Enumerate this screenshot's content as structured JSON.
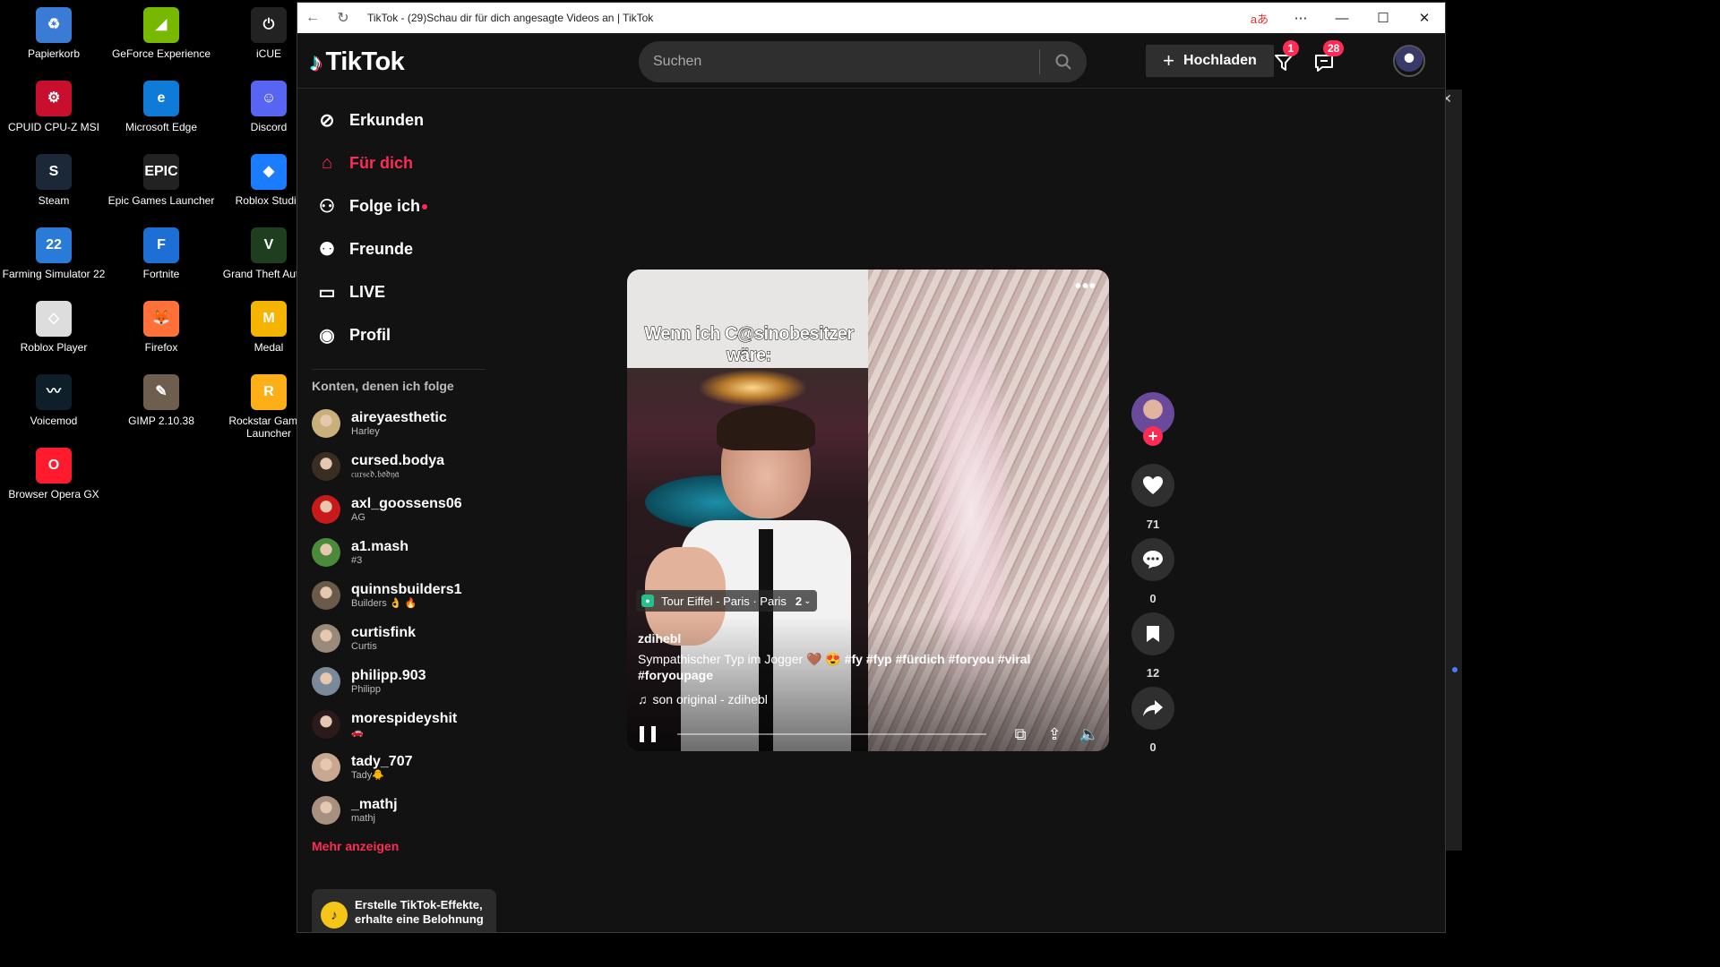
{
  "desktop": {
    "icons": [
      {
        "label": "Papierkorb",
        "icon": "recycle-bin-icon",
        "glyph": "♻",
        "color": "#3a7bd5"
      },
      {
        "label": "GeForce Experience",
        "icon": "geforce-icon",
        "glyph": "◢",
        "color": "#76b900"
      },
      {
        "label": "iCUE",
        "icon": "icue-icon",
        "glyph": "⏻",
        "color": "#222"
      },
      {
        "label": "CPUID CPU-Z MSI",
        "icon": "cpuz-icon",
        "glyph": "⚙",
        "color": "#c8102e"
      },
      {
        "label": "Microsoft Edge",
        "icon": "edge-icon",
        "glyph": "e",
        "color": "#0f7bd8"
      },
      {
        "label": "Discord",
        "icon": "discord-icon",
        "glyph": "☺",
        "color": "#5865f2"
      },
      {
        "label": "Steam",
        "icon": "steam-icon",
        "glyph": "S",
        "color": "#1b2838"
      },
      {
        "label": "Epic Games Launcher",
        "icon": "epic-icon",
        "glyph": "EPIC",
        "color": "#222"
      },
      {
        "label": "Roblox Studio",
        "icon": "roblox-studio-icon",
        "glyph": "◆",
        "color": "#1a7cff"
      },
      {
        "label": "Farming Simulator 22",
        "icon": "farming-sim-icon",
        "glyph": "22",
        "color": "#2a7bd8"
      },
      {
        "label": "Fortnite",
        "icon": "fortnite-icon",
        "glyph": "F",
        "color": "#1d6fd6"
      },
      {
        "label": "Grand Theft Auto V",
        "icon": "gta-icon",
        "glyph": "V",
        "color": "#1f3d1f"
      },
      {
        "label": "Roblox Player",
        "icon": "roblox-player-icon",
        "glyph": "◇",
        "color": "#ddd"
      },
      {
        "label": "Firefox",
        "icon": "firefox-icon",
        "glyph": "🦊",
        "color": "#ff7139"
      },
      {
        "label": "Medal",
        "icon": "medal-icon",
        "glyph": "M",
        "color": "#f5b400"
      },
      {
        "label": "Voicemod",
        "icon": "voicemod-icon",
        "glyph": "〰",
        "color": "#0f1f2a"
      },
      {
        "label": "GIMP 2.10.38",
        "icon": "gimp-icon",
        "glyph": "✎",
        "color": "#6e5e4e"
      },
      {
        "label": "Rockstar Games Launcher",
        "icon": "rockstar-icon",
        "glyph": "R",
        "color": "#fcaf17"
      },
      {
        "label": "Browser Opera GX",
        "icon": "opera-gx-icon",
        "glyph": "O",
        "color": "#ff1b2d"
      }
    ]
  },
  "browser": {
    "title": "TikTok - (29)Schau dir für dich angesagte Videos an | TikTok"
  },
  "header": {
    "logo": "TikTok",
    "search_placeholder": "Suchen",
    "upload_label": "Hochladen",
    "inbox_badge": "1",
    "messages_badge": "28"
  },
  "sidebar": {
    "nav": [
      {
        "label": "Erkunden",
        "icon": "compass-icon",
        "glyph": "⊘",
        "active": false
      },
      {
        "label": "Für dich",
        "icon": "home-icon",
        "glyph": "⌂",
        "active": true
      },
      {
        "label": "Folge ich",
        "icon": "following-icon",
        "glyph": "⚇",
        "active": false,
        "dot": true
      },
      {
        "label": "Freunde",
        "icon": "friends-icon",
        "glyph": "⚉",
        "active": false
      },
      {
        "label": "LIVE",
        "icon": "live-icon",
        "glyph": "▭",
        "active": false
      },
      {
        "label": "Profil",
        "icon": "profile-avatar-icon",
        "glyph": "◉",
        "active": false
      }
    ],
    "following_heading": "Konten, denen ich folge",
    "accounts": [
      {
        "name": "aireyaesthetic",
        "sub": "Harley",
        "color": "#c9b07a"
      },
      {
        "name": "cursed.bodya",
        "sub": "𝔠𝔲𝔯𝔰𝔢𝔡.𝔟𝔬𝔡𝔶𝔞",
        "color": "#3a2e22"
      },
      {
        "name": "axl_goossens06",
        "sub": "AG",
        "color": "#c81a1a"
      },
      {
        "name": "a1.mash",
        "sub": "#3",
        "color": "#4a8a3a"
      },
      {
        "name": "quinnsbuilders1",
        "sub": "Builders 👌 🔥",
        "color": "#6a5a4a"
      },
      {
        "name": "curtisfink",
        "sub": "Curtis",
        "color": "#9a8a7a"
      },
      {
        "name": "philipp.903",
        "sub": "Philipp",
        "color": "#7a8a9a"
      },
      {
        "name": "morespideyshit",
        "sub": "🚗",
        "color": "#2a1a1a"
      },
      {
        "name": "tady_707",
        "sub": "Tady🐥",
        "color": "#c8a890"
      },
      {
        "name": "_mathj",
        "sub": "mathj",
        "color": "#a89080"
      }
    ],
    "more_label": "Mehr anzeigen",
    "effects_text": "Erstelle TikTok-Effekte, erhalte eine Belohnung"
  },
  "video": {
    "overlay_text": "Wenn ich C@sinobesitzer wäre:",
    "location": "Tour Eiffel - Paris · Paris",
    "location_count": "2",
    "author": "zdihebl",
    "description_text": "Sympathischer Typ im Jogger 🤎 😍 ",
    "hashtags": "#fy  #fyp  #fürdich  #foryou  #viral  #foryoupage",
    "music": "son original - zdihebl",
    "progress": 0.0
  },
  "actions": {
    "likes": "71",
    "comments": "0",
    "saves": "12",
    "shares": "0"
  }
}
